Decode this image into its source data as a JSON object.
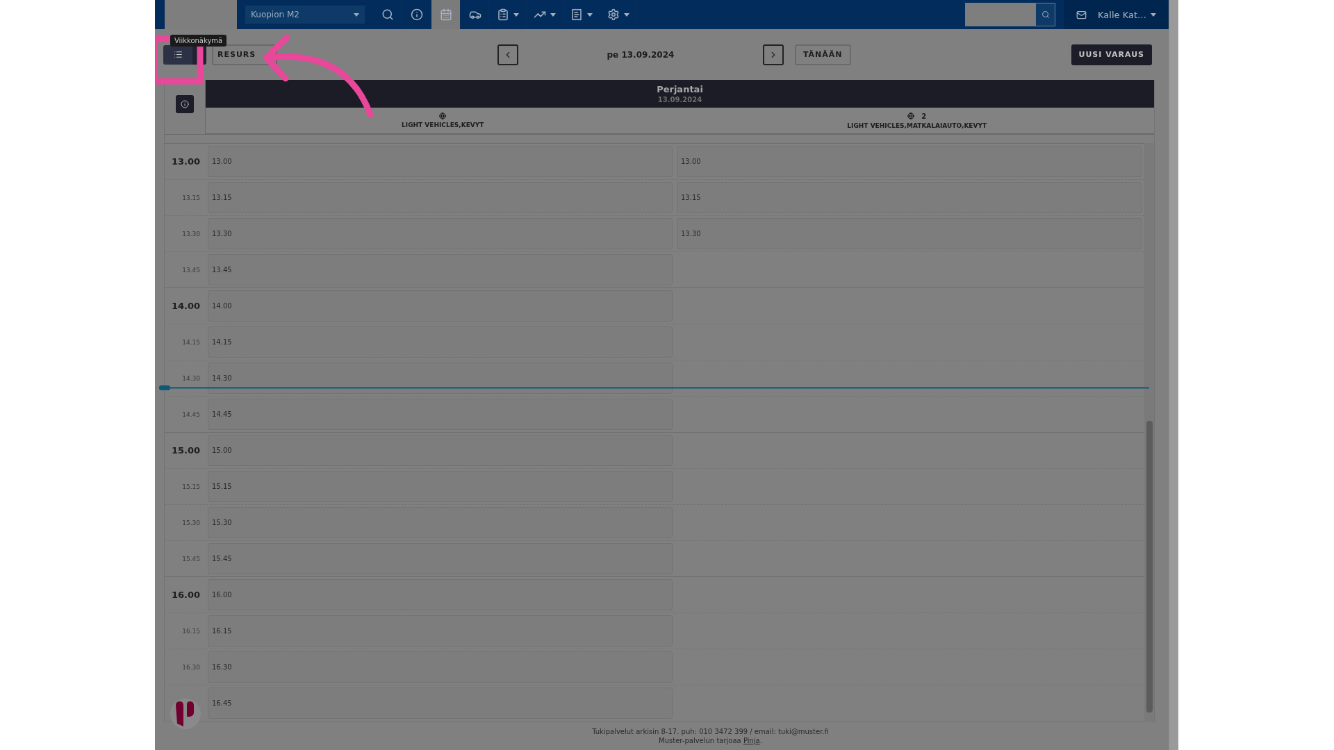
{
  "nav": {
    "location": "Kuopion M2",
    "items": [
      {
        "selected": false,
        "dropdown": false
      },
      {
        "selected": false,
        "dropdown": false
      },
      {
        "selected": true,
        "dropdown": false
      },
      {
        "selected": false,
        "dropdown": false
      },
      {
        "selected": false,
        "dropdown": true
      },
      {
        "selected": false,
        "dropdown": true
      },
      {
        "selected": false,
        "dropdown": true
      },
      {
        "selected": false,
        "dropdown": true
      }
    ],
    "user": "Kalle Kat…"
  },
  "toolbar": {
    "views": [
      {
        "selected": true
      },
      {
        "selected": false
      }
    ],
    "tooltip": "Viikkonäkymä",
    "resources_button": "RESURS",
    "date": "pe 13.09.2024",
    "today_button": "TÄNÄÄN",
    "new_button": "UUSI VARAUS"
  },
  "calendar": {
    "day": "Perjantai",
    "date": "13.09.2024",
    "resources": [
      {
        "label": "LIGHT VEHICLES,KEVYT"
      },
      {
        "count": "2",
        "label": "LIGHT VEHICLES,MATKALAIAUTO,KEVYT"
      }
    ],
    "rows": [
      {
        "time": "13.00",
        "major": true,
        "slots": [
          "13.00",
          "13.00"
        ]
      },
      {
        "time": "13.15",
        "major": false,
        "slots": [
          "13.15",
          "13.15"
        ]
      },
      {
        "time": "13.30",
        "major": false,
        "slots": [
          "13.30",
          "13.30"
        ]
      },
      {
        "time": "13.45",
        "major": false,
        "slots": [
          "13.45"
        ]
      },
      {
        "time": "14.00",
        "major": true,
        "slots": [
          "14.00"
        ]
      },
      {
        "time": "14.15",
        "major": false,
        "slots": [
          "14.15"
        ]
      },
      {
        "time": "14.30",
        "major": false,
        "slots": [
          "14.30"
        ]
      },
      {
        "time": "14.45",
        "major": false,
        "slots": [
          "14.45"
        ]
      },
      {
        "time": "15.00",
        "major": true,
        "slots": [
          "15.00"
        ]
      },
      {
        "time": "15.15",
        "major": false,
        "slots": [
          "15.15"
        ]
      },
      {
        "time": "15.30",
        "major": false,
        "slots": [
          "15.30"
        ]
      },
      {
        "time": "15.45",
        "major": false,
        "slots": [
          "15.45"
        ]
      },
      {
        "time": "16.00",
        "major": true,
        "slots": [
          "16.00"
        ]
      },
      {
        "time": "16.15",
        "major": false,
        "slots": [
          "16.15"
        ]
      },
      {
        "time": "16.30",
        "major": false,
        "slots": [
          "16.30"
        ]
      },
      {
        "major": false,
        "slots": [
          "16.45"
        ]
      }
    ]
  },
  "footer": {
    "support": "Tukipalvelut arkisin 8-17. puh: 010 3472 399 / email: tuki@muster.fi",
    "provider": "Muster-palvelun tarjoaa ",
    "link": "Pinja",
    "end": "."
  }
}
